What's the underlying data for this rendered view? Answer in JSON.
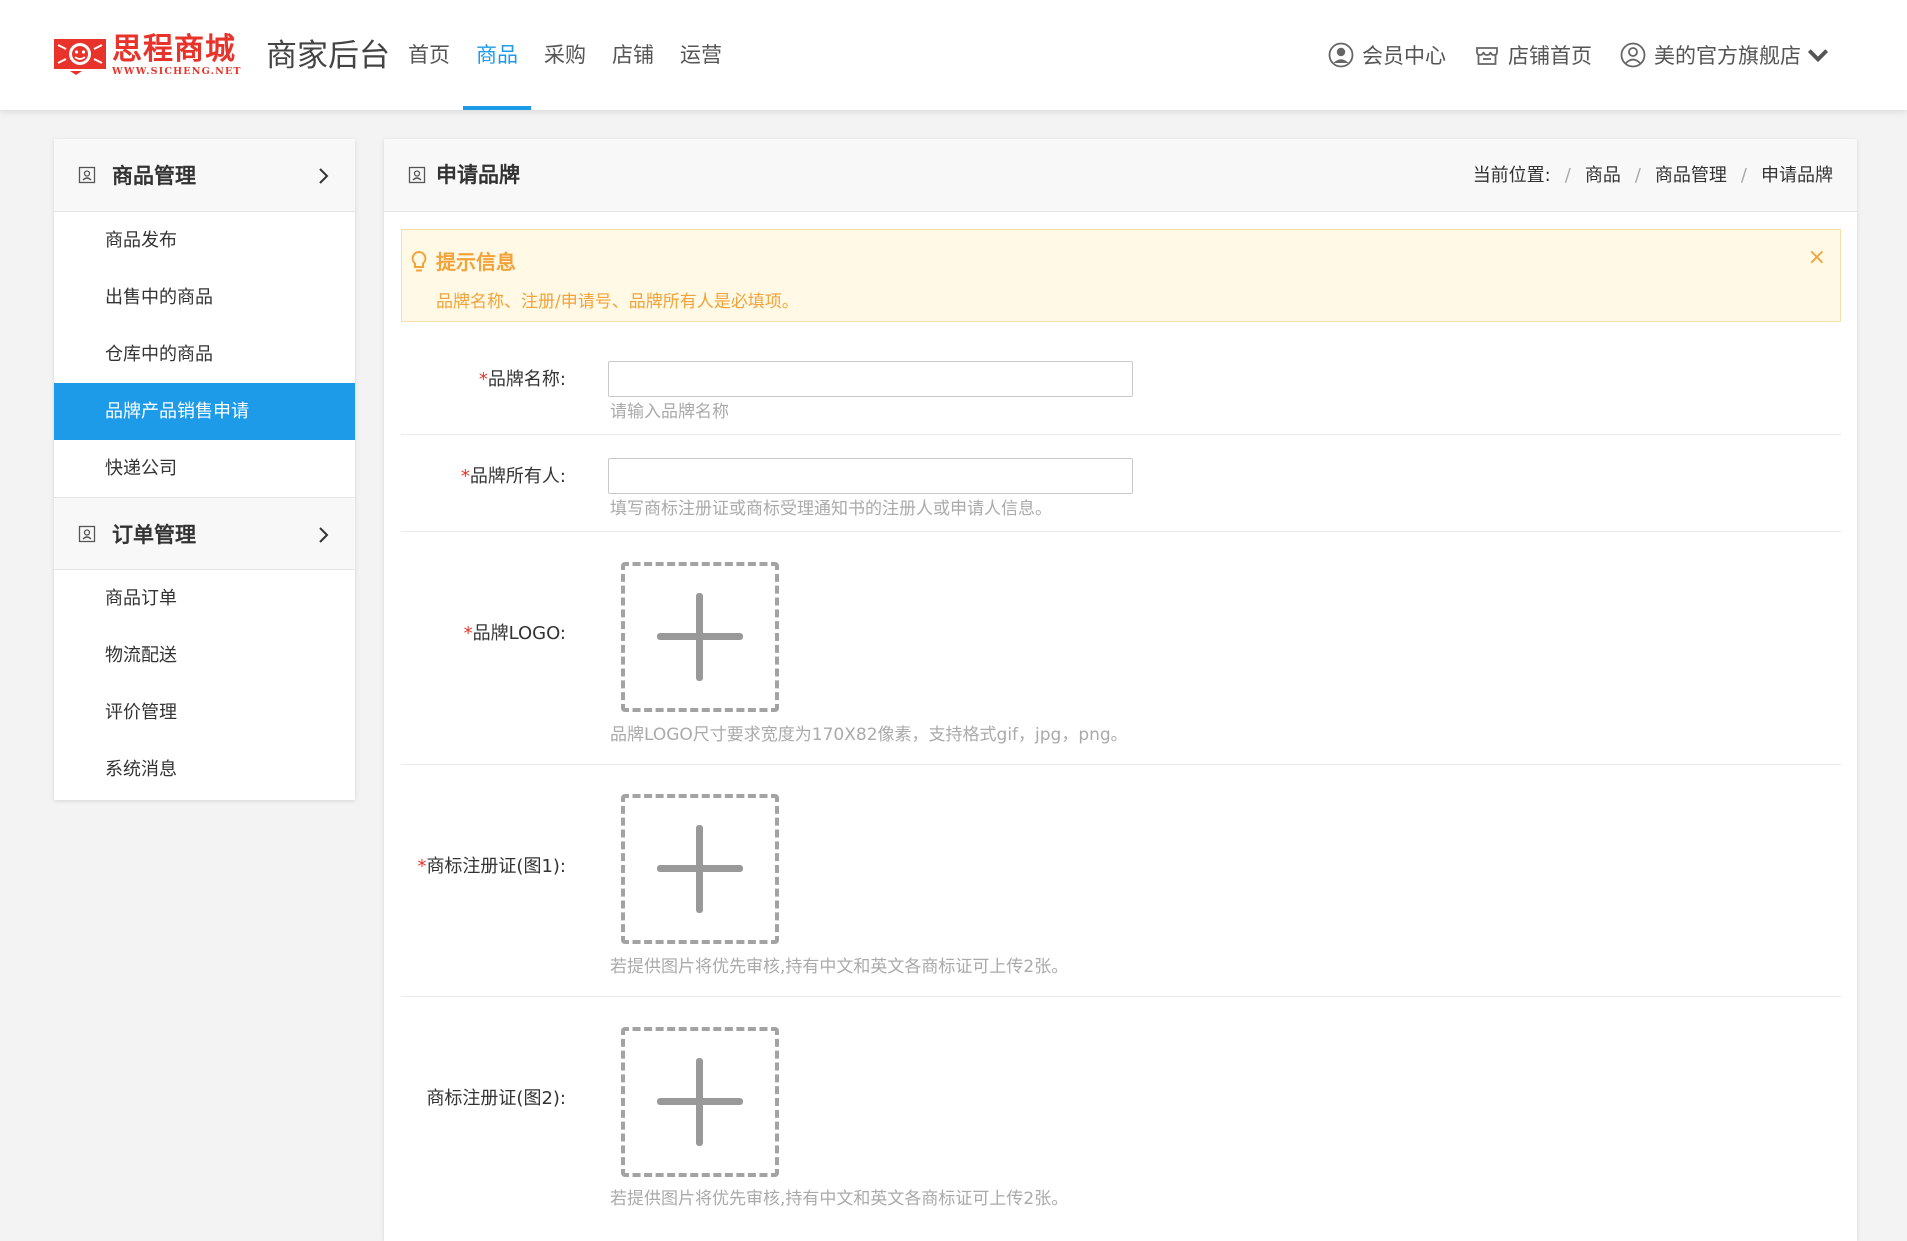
{
  "header": {
    "logo_main": "思程商城",
    "logo_sub": "WWW.SICHENG.NET",
    "app_title": "商家后台",
    "nav": [
      {
        "label": "首页",
        "active": false
      },
      {
        "label": "商品",
        "active": true
      },
      {
        "label": "采购",
        "active": false
      },
      {
        "label": "店铺",
        "active": false
      },
      {
        "label": "运营",
        "active": false
      }
    ],
    "right_nav": {
      "member_center": "会员中心",
      "store_home": "店铺首页",
      "store_name": "美的官方旗舰店"
    }
  },
  "sidebar": {
    "groups": [
      {
        "title": "商品管理",
        "items": [
          {
            "label": "商品发布",
            "active": false
          },
          {
            "label": "出售中的商品",
            "active": false
          },
          {
            "label": "仓库中的商品",
            "active": false
          },
          {
            "label": "品牌产品销售申请",
            "active": true
          },
          {
            "label": "快递公司",
            "active": false
          }
        ]
      },
      {
        "title": "订单管理",
        "items": [
          {
            "label": "商品订单",
            "active": false
          },
          {
            "label": "物流配送",
            "active": false
          },
          {
            "label": "评价管理",
            "active": false
          },
          {
            "label": "系统消息",
            "active": false
          }
        ]
      }
    ]
  },
  "panel": {
    "title": "申请品牌",
    "breadcrumb": {
      "prefix": "当前位置:",
      "items": [
        "商品",
        "商品管理",
        "申请品牌"
      ]
    },
    "notice": {
      "title": "提示信息",
      "text": "品牌名称、注册/申请号、品牌所有人是必填项。",
      "close": "×"
    },
    "form": {
      "brand_name": {
        "required": "*",
        "label": "品牌名称:",
        "value": "",
        "hint": "请输入品牌名称"
      },
      "brand_owner": {
        "required": "*",
        "label": "品牌所有人:",
        "value": "",
        "hint": "填写商标注册证或商标受理通知书的注册人或申请人信息。"
      },
      "brand_logo": {
        "required": "*",
        "label": "品牌LOGO:",
        "hint": "品牌LOGO尺寸要求宽度为170X82像素，支持格式gif，jpg，png。"
      },
      "cert1": {
        "required": "*",
        "label": "商标注册证(图1):",
        "hint": "若提供图片将优先审核,持有中文和英文各商标证可上传2张。"
      },
      "cert2": {
        "label": "商标注册证(图2):",
        "hint": "若提供图片将优先审核,持有中文和英文各商标证可上传2张。"
      }
    }
  },
  "colors": {
    "accent": "#1e9be8",
    "brand_red": "#e8332a",
    "notice_orange": "#f2a33a",
    "notice_bg": "#fff9e6"
  }
}
